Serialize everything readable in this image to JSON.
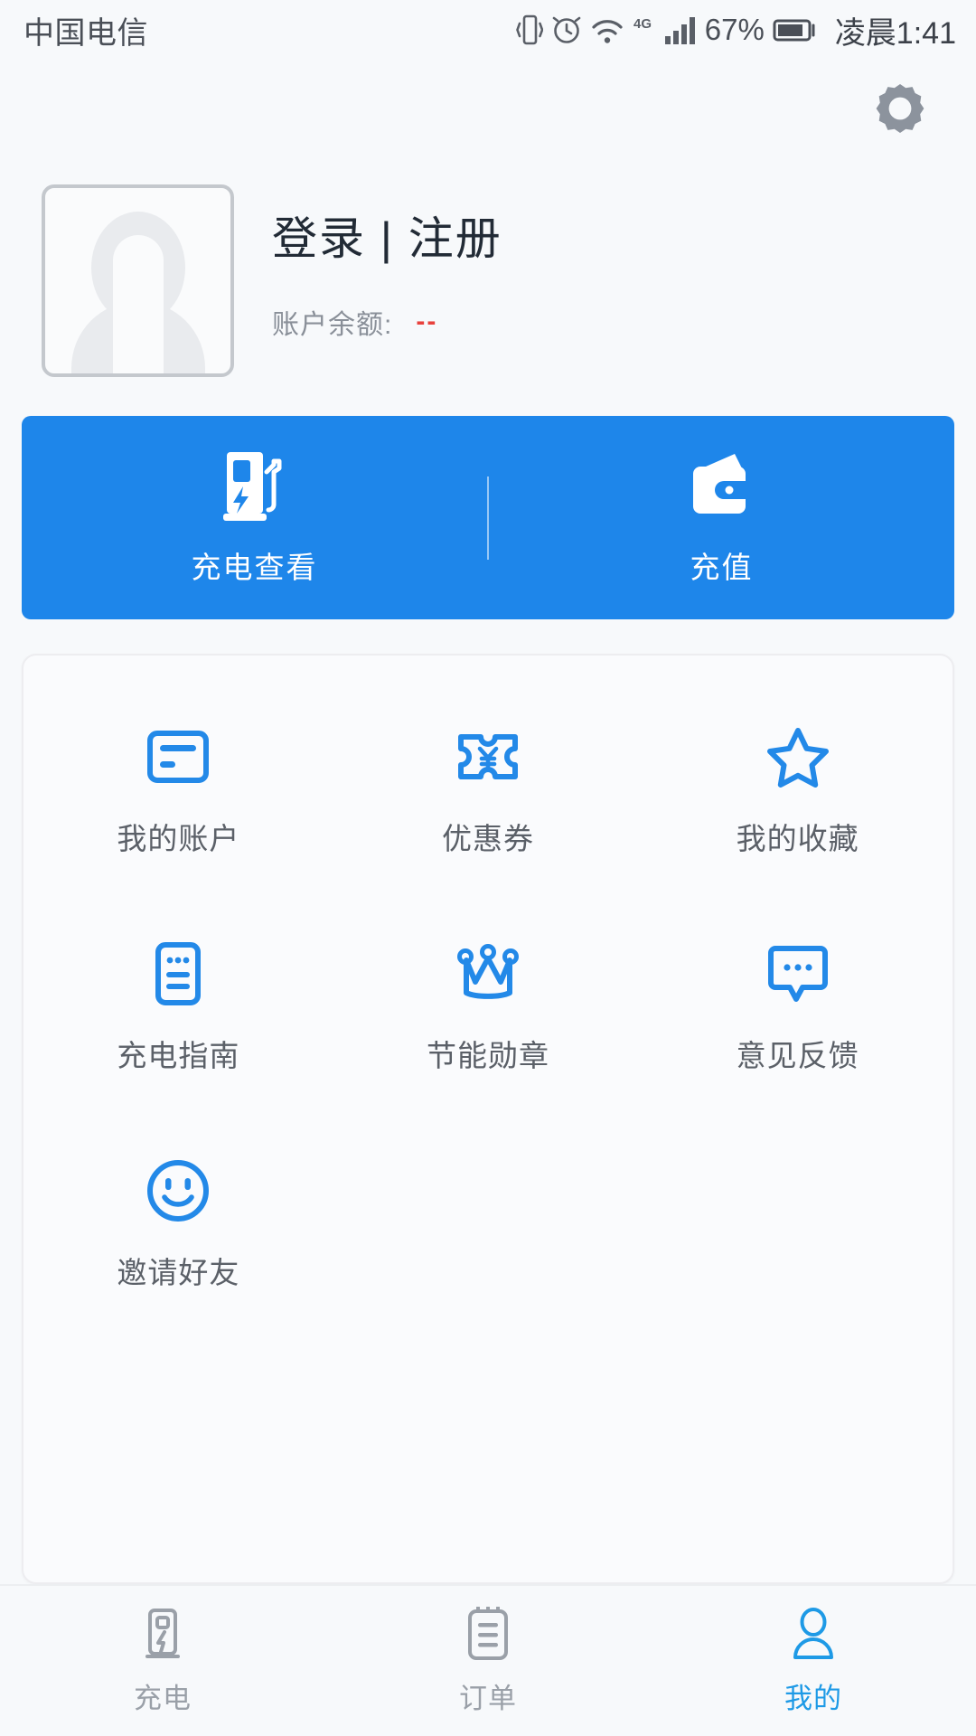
{
  "status_bar": {
    "carrier": "中国电信",
    "battery_percent": "67%",
    "time": "凌晨1:41",
    "network": "4G",
    "icons": [
      "vibrate-icon",
      "alarm-icon",
      "wifi-icon",
      "network-4g-icon",
      "signal-icon",
      "battery-icon"
    ]
  },
  "header": {
    "settings_icon": "gear-icon"
  },
  "profile": {
    "title": "登录 | 注册",
    "balance_label": "账户余额:",
    "balance_value": "--",
    "avatar_icon": "avatar-placeholder-icon"
  },
  "action_bar": {
    "bg_color": "#1e86ea",
    "items": [
      {
        "label": "充电查看",
        "icon": "charging-pile-icon"
      },
      {
        "label": "充值",
        "icon": "wallet-icon"
      }
    ]
  },
  "grid": {
    "accent_color": "#2389e8",
    "rows": [
      [
        {
          "label": "我的账户",
          "icon": "card-icon"
        },
        {
          "label": "优惠券",
          "icon": "coupon-ticket-icon"
        },
        {
          "label": "我的收藏",
          "icon": "star-icon"
        }
      ],
      [
        {
          "label": "充电指南",
          "icon": "guide-document-icon"
        },
        {
          "label": "节能勋章",
          "icon": "crown-icon"
        },
        {
          "label": "意见反馈",
          "icon": "feedback-bubble-icon"
        }
      ],
      [
        {
          "label": "邀请好友",
          "icon": "smiley-face-icon"
        }
      ]
    ]
  },
  "bottom_nav": {
    "active_color": "#1e9ae6",
    "inactive_color": "#9aa0a8",
    "items": [
      {
        "label": "充电",
        "icon": "charging-pile-nav-icon",
        "active": false
      },
      {
        "label": "订单",
        "icon": "order-list-nav-icon",
        "active": false
      },
      {
        "label": "我的",
        "icon": "person-nav-icon",
        "active": true
      }
    ]
  }
}
